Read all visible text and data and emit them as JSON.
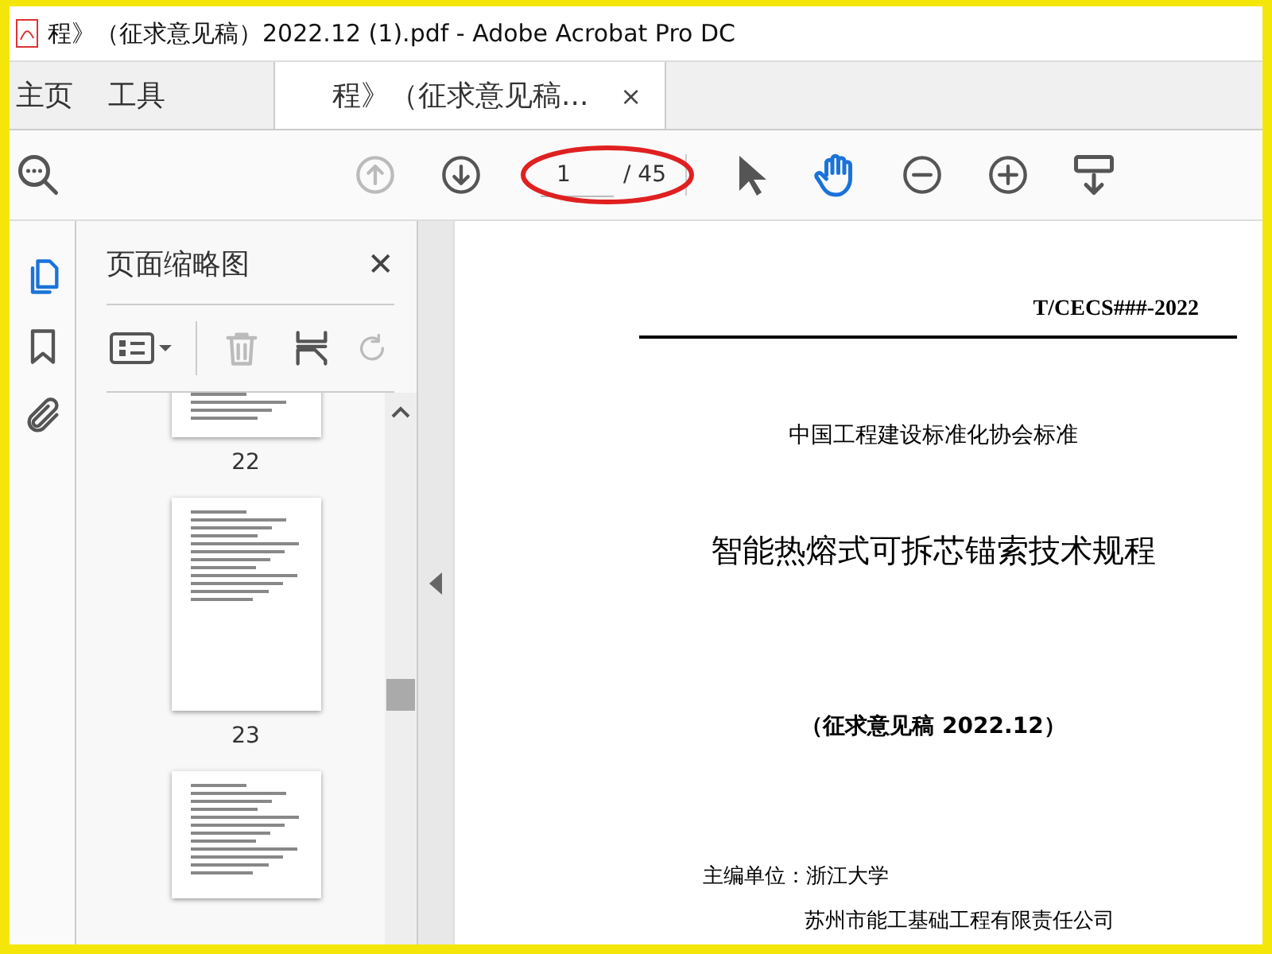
{
  "window": {
    "title": "程》（征求意见稿）2022.12 (1).pdf - Adobe Acrobat Pro DC"
  },
  "tabs": [
    {
      "label": "主页",
      "kind": "plain",
      "selected": false
    },
    {
      "label": "工具",
      "kind": "plain",
      "selected": false
    },
    {
      "label": "程》（征求意见稿...",
      "kind": "document",
      "selected": true,
      "close": "×"
    }
  ],
  "toolbar": {
    "page_input": "1",
    "page_total": "/ 45",
    "hand_tool_selected": true
  },
  "side_panel": {
    "title": "页面缩略图",
    "close": "✕",
    "thumbnails": [
      {
        "label": "22",
        "kind": "tail"
      },
      {
        "label": "23",
        "kind": "full"
      },
      {
        "kind": "head"
      }
    ]
  },
  "document": {
    "code": "T/CECS###-2022",
    "org": "中国工程建设标准化协会标准",
    "title": "智能热熔式可拆芯锚索技术规程",
    "edition": "（征求意见稿 2022.12）",
    "editor_label": "主编单位：",
    "editor": "浙江大学",
    "co_editor": "苏州市能工基础工程有限责任公司"
  }
}
